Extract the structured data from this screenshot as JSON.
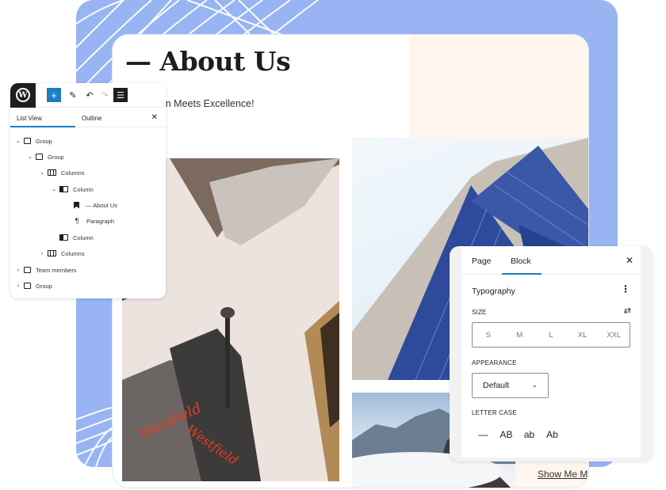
{
  "page": {
    "title": "— About Us",
    "subtitle": "Innovation Meets Excellence!",
    "show_more_link": "Show Me More",
    "images": [
      {
        "name": "street-towers-photo",
        "description": "Looking up at city towers with Westfield signage"
      },
      {
        "name": "blue-glass-building-photo",
        "description": "Angled blue glass skyscraper"
      },
      {
        "name": "mountain-peaks-photo",
        "description": "Snowy mountain peaks above clouds"
      }
    ]
  },
  "colors": {
    "backdrop": "#98b4f2",
    "accent": "#1e7ec4",
    "cream": "#fff6ef",
    "dark": "#1e1e1e"
  },
  "toolbar": {
    "logo": "W",
    "add_label": "+",
    "edit_icon": "✎",
    "undo_icon": "↶",
    "redo_icon": "↷",
    "list_view_icon": "☰"
  },
  "list_view": {
    "tabs": [
      "List View",
      "Outline"
    ],
    "active_tab": "List View",
    "close_label": "✕",
    "items": [
      {
        "label": "Group",
        "depth": 0,
        "expanded": true,
        "icon": "group"
      },
      {
        "label": "Group",
        "depth": 1,
        "expanded": true,
        "icon": "group"
      },
      {
        "label": "Columns",
        "depth": 2,
        "expanded": true,
        "icon": "columns"
      },
      {
        "label": "Column",
        "depth": 3,
        "expanded": true,
        "icon": "column"
      },
      {
        "label": "— About Us",
        "depth": 4,
        "expanded": null,
        "icon": "heading"
      },
      {
        "label": "Paragraph",
        "depth": 4,
        "expanded": null,
        "icon": "paragraph"
      },
      {
        "label": "Column",
        "depth": 3,
        "expanded": null,
        "icon": "column"
      },
      {
        "label": "Columns",
        "depth": 2,
        "expanded": false,
        "icon": "columns"
      },
      {
        "label": "Team members",
        "depth": 0,
        "expanded": false,
        "icon": "group"
      },
      {
        "label": "Group",
        "depth": 0,
        "expanded": false,
        "icon": "group"
      }
    ]
  },
  "settings": {
    "tabs": [
      "Page",
      "Block"
    ],
    "active_tab": "Block",
    "close_label": "✕",
    "section_title": "Typography",
    "size_label": "SIZE",
    "size_options": [
      "S",
      "M",
      "L",
      "XL",
      "XXL"
    ],
    "appearance_label": "APPEARANCE",
    "appearance_value": "Default",
    "letter_case_label": "LETTER CASE",
    "letter_case_options": [
      "—",
      "AB",
      "ab",
      "Ab"
    ]
  }
}
